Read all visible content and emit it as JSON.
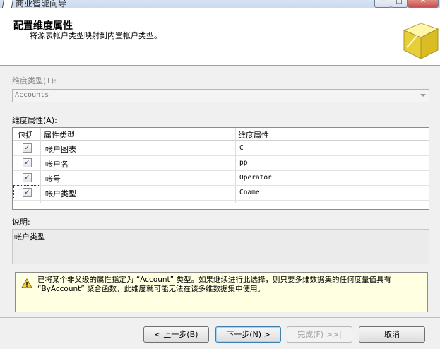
{
  "window": {
    "title": "商业智能向导",
    "controls": {
      "minimize": "—",
      "maximize": "□",
      "close": "✕"
    }
  },
  "header": {
    "title": "配置维度属性",
    "subtitle": "将源表帐户类型映射到内置帐户类型。",
    "icon": "cube-icon"
  },
  "dimension_type": {
    "label": "维度类型(T):",
    "value": "Accounts"
  },
  "attributes": {
    "label": "维度属性(A):",
    "columns": [
      "包括",
      "属性类型",
      "维度属性"
    ],
    "rows": [
      {
        "checked": "✓",
        "type": "帐户图表",
        "attribute": "C"
      },
      {
        "checked": "✓",
        "type": "帐户名",
        "attribute": "pp"
      },
      {
        "checked": "✓",
        "type": "帐号",
        "attribute": "Operator"
      },
      {
        "checked": "✓",
        "type": "帐户类型",
        "attribute": "Cname"
      }
    ]
  },
  "description": {
    "label": "说明:",
    "text": "帐户类型"
  },
  "warning": {
    "icon": "warning-icon",
    "text": "已将某个非父级的属性指定为 “Account” 类型。如果继续进行此选择，则只要多维数据集的任何度量值具有 “ByAccount” 聚合函数，此维度就可能无法在该多维数据集中使用。"
  },
  "buttons": {
    "back": "< 上一步(B)",
    "next": "下一步(N) >",
    "finish": "完成(F) >>|",
    "cancel": "取消"
  }
}
